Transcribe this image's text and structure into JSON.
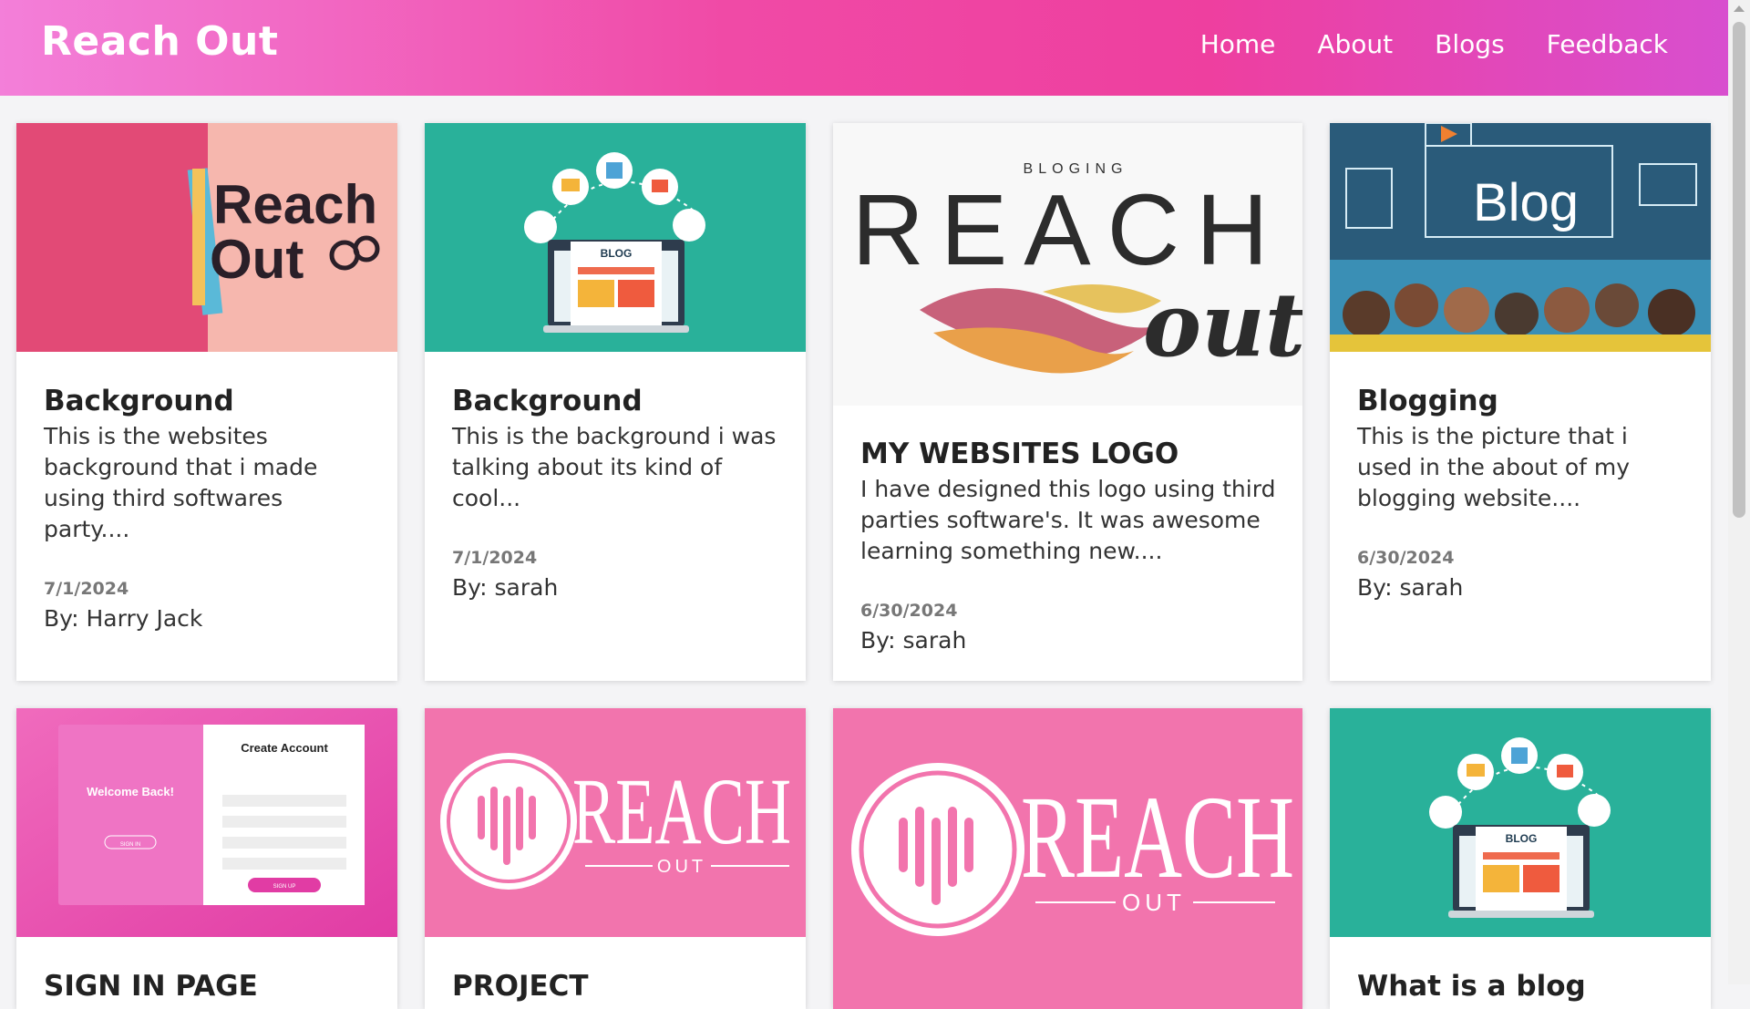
{
  "header": {
    "brand": "Reach Out",
    "nav": [
      {
        "label": "Home"
      },
      {
        "label": "About"
      },
      {
        "label": "Blogs"
      },
      {
        "label": "Feedback"
      }
    ]
  },
  "cards": [
    {
      "title": "Background",
      "description": "This is the websites background that i made using third softwares party....",
      "date": "7/1/2024",
      "author": "By: Harry Jack",
      "image_text": [
        "Reach",
        "Out"
      ]
    },
    {
      "title": "Background",
      "description": "This is the background i was talking about its kind of cool...",
      "date": "7/1/2024",
      "author": "By: sarah",
      "image_text": [
        "BLOG"
      ]
    },
    {
      "title": "MY WEBSITES LOGO",
      "description": "I have designed this logo using third parties software's. It was awesome learning something new....",
      "date": "6/30/2024",
      "author": "By: sarah",
      "image_text": [
        "BLOGING",
        "REACH",
        "out"
      ]
    },
    {
      "title": "Blogging",
      "description": "This is the picture that i used in the about of my blogging website....",
      "date": "6/30/2024",
      "author": "By: sarah",
      "image_text": [
        "Blog"
      ]
    },
    {
      "title": "SIGN IN PAGE",
      "image_text": [
        "Welcome Back!",
        "Create Account",
        "SIGN IN",
        "SIGN UP"
      ]
    },
    {
      "title": "PROJECT",
      "image_text": [
        "REACH",
        "OUT"
      ]
    },
    {
      "title": "",
      "image_text": [
        "REACH",
        "OUT"
      ]
    },
    {
      "title": "What is a blog",
      "image_text": [
        "BLOG"
      ]
    }
  ],
  "colors": {
    "header_start": "#f37fd9",
    "header_mid": "#ee3f9f",
    "header_end": "#d84fcf",
    "teal": "#29b19a",
    "pink": "#f274ad"
  }
}
